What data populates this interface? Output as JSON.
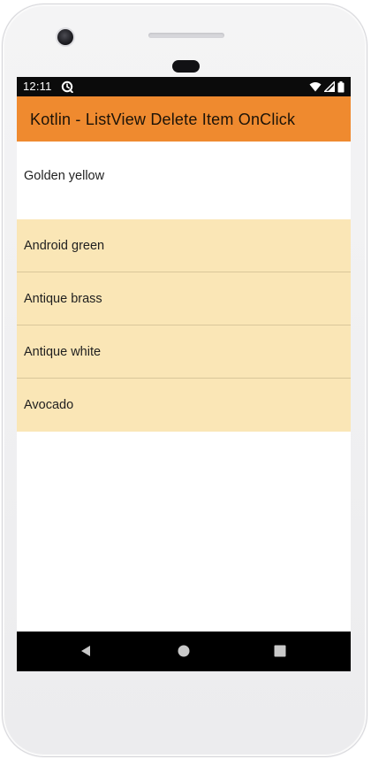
{
  "status_bar": {
    "time": "12:11",
    "app_icon": "sync-icon",
    "icons": [
      "wifi-icon",
      "signal-icon",
      "battery-icon"
    ]
  },
  "app_bar": {
    "title": "Kotlin - ListView Delete Item OnClick",
    "color": "#ef8a2f"
  },
  "list": {
    "items": [
      {
        "label": "Golden yellow",
        "highlighted": false
      },
      {
        "label": "Android green",
        "highlighted": true
      },
      {
        "label": "Antique brass",
        "highlighted": true
      },
      {
        "label": "Antique white",
        "highlighted": true
      },
      {
        "label": "Avocado",
        "highlighted": true
      }
    ],
    "highlight_color": "#fae6b6"
  },
  "nav_bar": {
    "buttons": [
      "back-icon",
      "home-icon",
      "recents-icon"
    ]
  }
}
